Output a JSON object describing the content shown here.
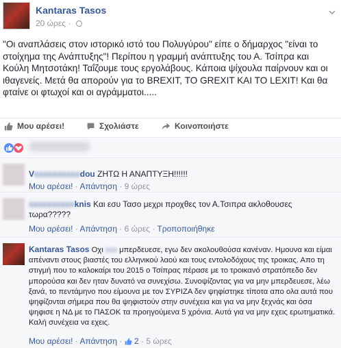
{
  "post": {
    "author": "Kantaras Tasos",
    "time": "20 ώρες",
    "text": "\"Οι αναπλάσεις στον ιστορικό ιστό του Πολυγύρου\" είπε ο δήμαρχος \"είναι το στοίχημα της Ανάπτυξης\"! Περίπου η γραμμή ανάπτυξης του Α. Τσίπρα και Κούλη Μητσοτάκη! Ταΐζουμε τους εργολάβους. Κάποια ψίχουλα παίρνουν και οι ιθαγενείς. Μετά θα απορούν για το BREXIT, ΤΟ GREXIT ΚΑΙ ΤΟ LEXIT! Και θα φταίνε οι φτωχοί και οι αγράμματοι.....",
    "actions": {
      "like": "Μου αρέσει!",
      "comment": "Σχολιάστε",
      "share": "Κοινοποιήστε"
    }
  },
  "comments": [
    {
      "name_visible_start": "V",
      "name_visible_end": "dou",
      "text": "ΖΗΤΩ Η ΑΝΑΠΤΥΞΗ!!!!!!",
      "like": "Μου αρέσει!",
      "reply": "Απάντηση",
      "time": "9 ώρες"
    },
    {
      "name_visible_end": "knis",
      "text": "Και εσυ Τασο μεχρι προχθες τον Α.Τσιπρα ακλοθουσες τωρα?????",
      "like": "Μου αρέσει!",
      "reply": "Απάντηση",
      "time": "6 ώρες",
      "edited": "Τροποποιήθηκε"
    },
    {
      "name": "Kantaras Tasos",
      "text_start": "Οχι",
      "text": "μπερδευεσε, εγω δεν ακολουθούσα κανέναν. Ημουνα και είμαι απέναντι στους βιαστές του ελληνικού λαού και τους εντολοδόχους της τροικας. Απο τη στιγμή που το καλοκαίρι του 2015 ο Τσίπρας πέρασε με το τροικανό στρατόπεδο δεν μπορούσα και δεν ηταν δυνατό να συνεχίσω. Συνοψίζοντας για να μην μπερδευεσε, λέω ξανά, το πεντάμηνο που είμουνα με τον ΣΥΡΙΖΑ δεν ψηφίστηκε τίποτα απο ολα αυτά που ψηφίζονται σήμερα που θα ψηφιστούν στην συνέχεια και για να μην ξεχνάς και όσα ψηφισε η ΝΔ με το ΠΑΣΟΚ τα προηγούμενα 5 χρόνια. Αυτά για να μην εχεις ερωτηματικά. Καλή συνέχεια να εχεις.",
      "like": "Μου αρέσει!",
      "reply": "Απάντηση",
      "likes_count": "2",
      "time": "5 ώρες"
    }
  ],
  "colors": {
    "link": "#365899",
    "like_blue": "#5890ff",
    "love_red": "#f25268"
  }
}
